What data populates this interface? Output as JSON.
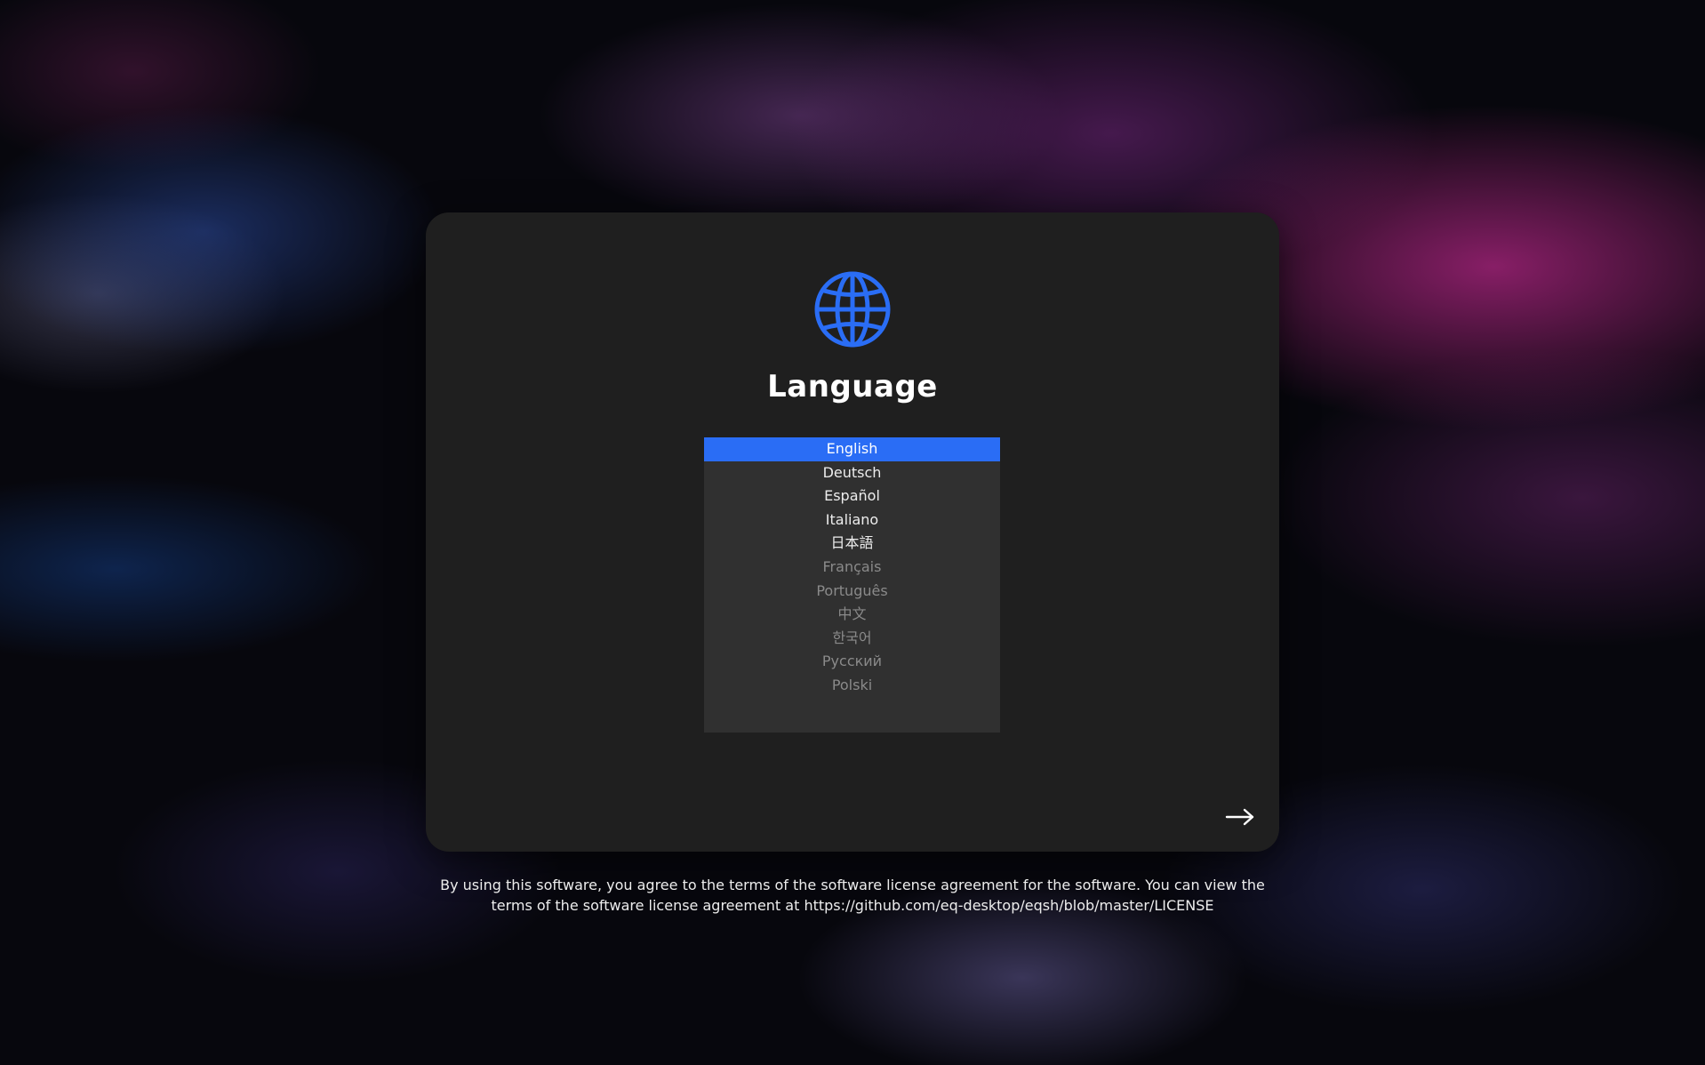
{
  "screen": {
    "title": "Language",
    "icon": "globe-icon",
    "accent_color": "#2a6df5"
  },
  "languages": [
    {
      "label": "English",
      "selected": true
    },
    {
      "label": "Deutsch"
    },
    {
      "label": "Español"
    },
    {
      "label": "Italiano"
    },
    {
      "label": "日本語"
    },
    {
      "label": "Français"
    },
    {
      "label": "Português"
    },
    {
      "label": "中文"
    },
    {
      "label": "한국어"
    },
    {
      "label": "Русский"
    },
    {
      "label": "Polski"
    }
  ],
  "next_button": {
    "icon": "arrow-right-icon"
  },
  "license": {
    "line1": "By using this software, you agree to the terms of the software license agreement for the software. You can view the",
    "line2": "terms of the software license agreement at https://github.com/eq-desktop/eqsh/blob/master/LICENSE"
  }
}
